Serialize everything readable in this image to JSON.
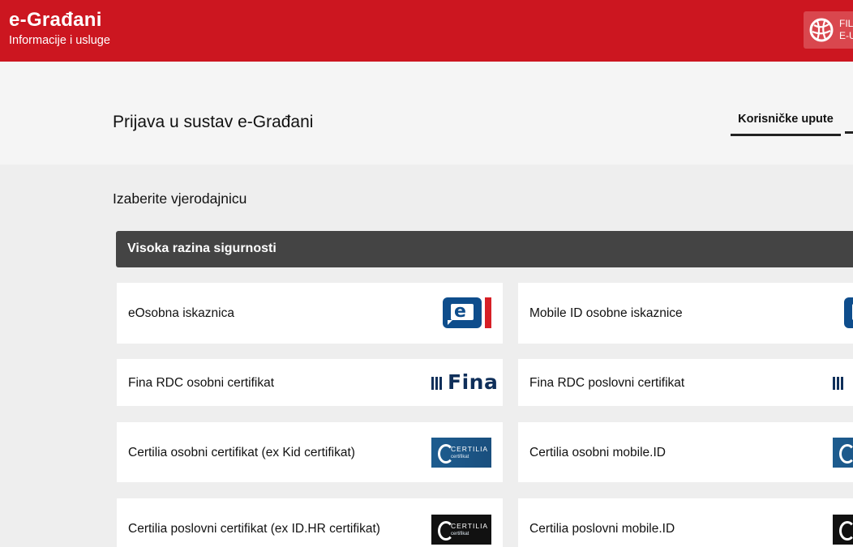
{
  "header": {
    "title": "e-Građani",
    "subtitle": "Informacije i usluge",
    "portal_button": "FIL\nE-U"
  },
  "page": {
    "title": "Prijava u sustav e-Građani",
    "guide_link": "Korisničke upute",
    "section_label": "Izaberite vjerodajnicu",
    "security_level": "Visoka razina sigurnosti"
  },
  "cards": [
    {
      "label": "eOsobna iskaznica",
      "logo": "eosobna-logo"
    },
    {
      "label": "Mobile ID osobne iskaznice",
      "logo": "eosobna-logo"
    },
    {
      "label": "Fina RDC osobni certifikat",
      "logo": "fina-logo",
      "logo_text": "Fina"
    },
    {
      "label": "Fina RDC poslovni certifikat",
      "logo": "fina-logo"
    },
    {
      "label": "Certilia osobni certifikat (ex Kid certifikat)",
      "logo": "certilia-logo",
      "logo_text": "CERTILIA",
      "logo_sub": "certifikat"
    },
    {
      "label": "Certilia osobni mobile.ID",
      "logo": "certilia-logo"
    },
    {
      "label": "Certilia poslovni certifikat (ex ID.HR certifikat)",
      "logo": "certilia-logo",
      "logo_text": "CERTILIA",
      "logo_sub": "certifikat"
    },
    {
      "label": "Certilia poslovni mobile.ID",
      "logo": "certilia-logo"
    }
  ],
  "colors": {
    "header_red": "#cc1620",
    "security_bar": "#444444",
    "fina_navy": "#0f2f5a",
    "certilia_blue": "#1d5c8f"
  }
}
